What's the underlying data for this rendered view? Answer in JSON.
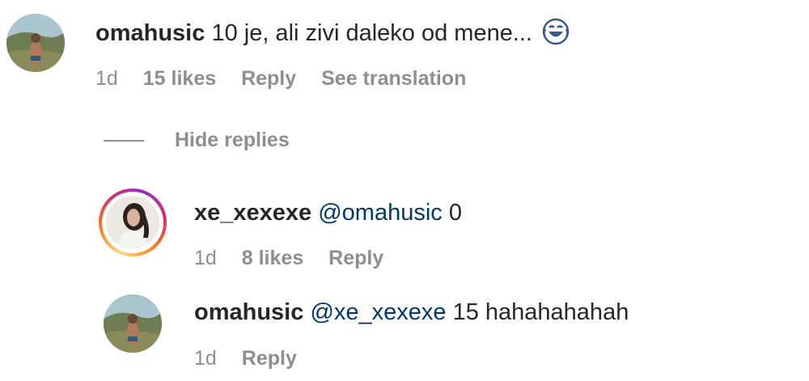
{
  "comment": {
    "username": "omahusic",
    "text": "10 je, ali zivi daleko od mene...",
    "emoji": "face-with-tears-of-joy",
    "age": "1d",
    "likes": "15 likes",
    "reply_label": "Reply",
    "translate_label": "See translation"
  },
  "hide_replies_label": "Hide replies",
  "replies": [
    {
      "username": "xe_xexexe",
      "mention": "@omahusic",
      "text": "0",
      "age": "1d",
      "likes": "8 likes",
      "reply_label": "Reply"
    },
    {
      "username": "omahusic",
      "mention": "@xe_xexexe",
      "text": "15 hahahahahah",
      "age": "1d",
      "reply_label": "Reply"
    }
  ],
  "colors": {
    "text": "#262626",
    "muted": "#8e8e8e",
    "mention": "#00376b"
  }
}
